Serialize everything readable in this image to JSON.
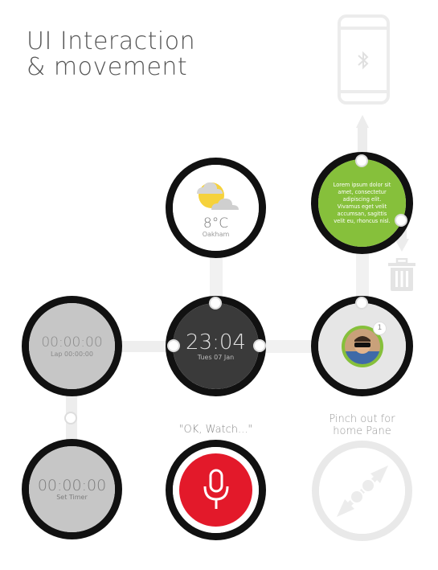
{
  "title": {
    "line1": "UI Interaction",
    "line2": "& movement"
  },
  "weather": {
    "temp": "8°C",
    "location": "Oakham"
  },
  "clock": {
    "time": "23:04",
    "date": "Tues 07 Jan"
  },
  "stopwatch": {
    "time": "00:00:00",
    "lap": "Lap 00:00:00"
  },
  "timer": {
    "time": "00:00:00",
    "label": "Set Timer"
  },
  "notification": {
    "text": "Lorem ipsum dolor sit amet, consectetur adipiscing elit. Vivamus eget velit accumsan, sagittis velit eu, rhoncus nisl."
  },
  "contact": {
    "badge": "1"
  },
  "voice": {
    "prompt": "\"OK, Watch...\""
  },
  "home_pane": {
    "hint_line1": "Pinch out for",
    "hint_line2": "home Pane"
  },
  "colors": {
    "green": "#86c03b",
    "red": "#e3192a",
    "dark_face": "#3a3a3a",
    "gray_face": "#c6c6c6",
    "weather_sun": "#f6d23c"
  },
  "icons": [
    "phone-icon",
    "bluetooth-icon",
    "trash-icon",
    "microphone-icon",
    "pinch-icon",
    "weather-icon"
  ]
}
